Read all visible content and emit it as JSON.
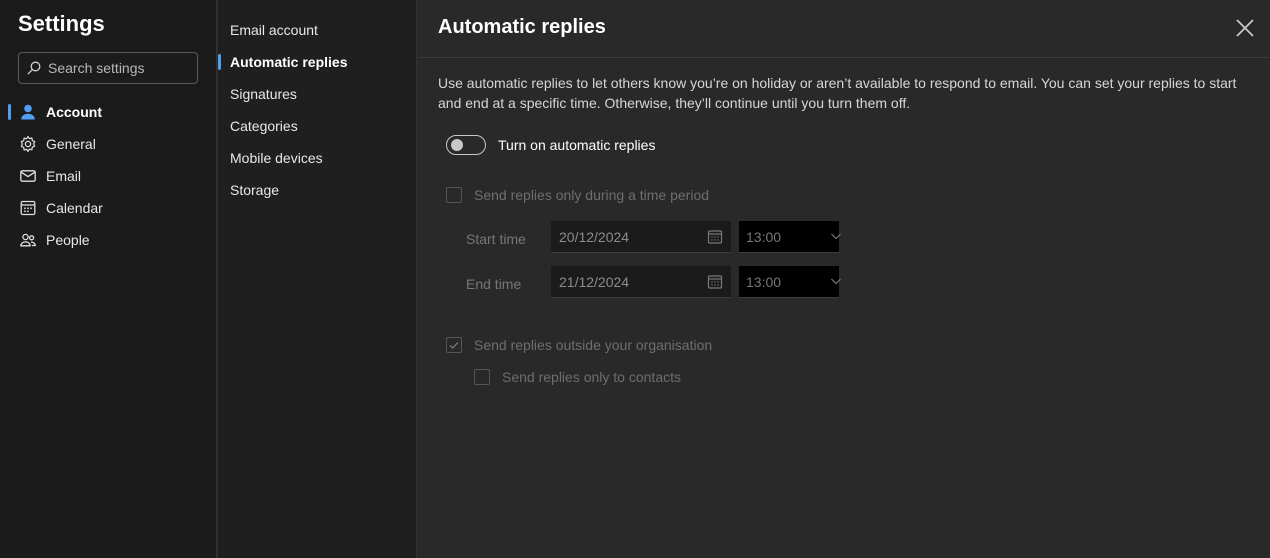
{
  "app": {
    "title": "Settings"
  },
  "search": {
    "placeholder": "Search settings",
    "value": ""
  },
  "nav": {
    "items": [
      {
        "label": "Account",
        "icon": "person-icon",
        "selected": true
      },
      {
        "label": "General",
        "icon": "gear-icon",
        "selected": false
      },
      {
        "label": "Email",
        "icon": "mail-icon",
        "selected": false
      },
      {
        "label": "Calendar",
        "icon": "calendar-icon",
        "selected": false
      },
      {
        "label": "People",
        "icon": "people-icon",
        "selected": false
      }
    ]
  },
  "subnav": {
    "items": [
      {
        "label": "Email account",
        "selected": false
      },
      {
        "label": "Automatic replies",
        "selected": true
      },
      {
        "label": "Signatures",
        "selected": false
      },
      {
        "label": "Categories",
        "selected": false
      },
      {
        "label": "Mobile devices",
        "selected": false
      },
      {
        "label": "Storage",
        "selected": false
      }
    ]
  },
  "main": {
    "title": "Automatic replies",
    "description": "Use automatic replies to let others know you’re on holiday or aren’t available to respond to email. You can set your replies to start and end at a specific time. Otherwise, they’ll continue until you turn them off.",
    "toggle": {
      "label": "Turn on automatic replies",
      "on": false
    },
    "time_period": {
      "label": "Send replies only during a time period",
      "checked": false
    },
    "start": {
      "label": "Start time",
      "date": "20/12/2024",
      "time": "13:00"
    },
    "end": {
      "label": "End time",
      "date": "21/12/2024",
      "time": "13:00"
    },
    "outside_org": {
      "label": "Send replies outside your organisation",
      "checked": true
    },
    "contacts_only": {
      "label": "Send replies only to contacts",
      "checked": false
    }
  },
  "colors": {
    "accent": "#4f9ef0",
    "background": "#292929",
    "nav_bg": "#1b1b1b"
  }
}
